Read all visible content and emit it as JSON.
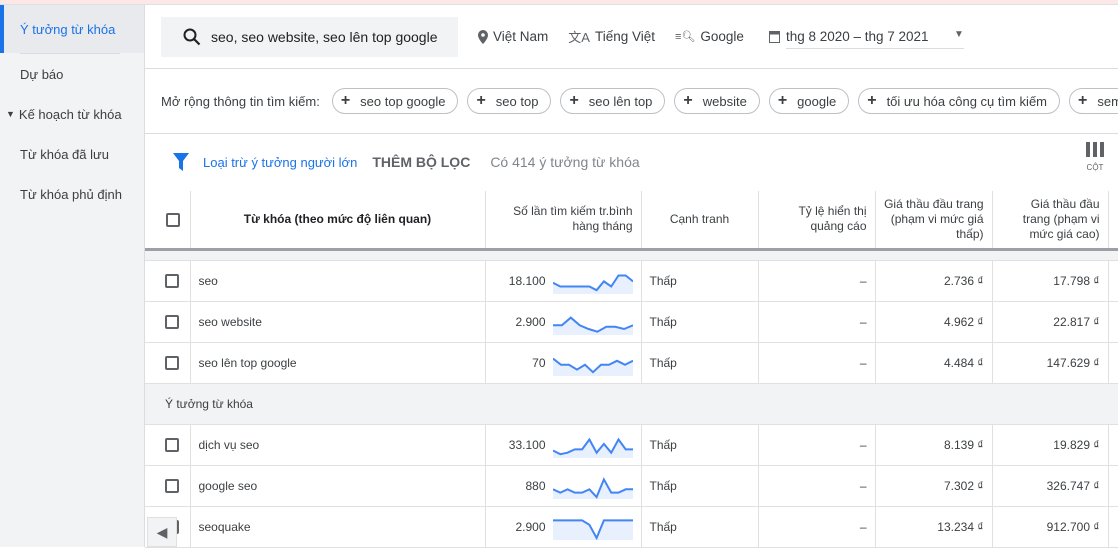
{
  "sidebar": {
    "items": [
      {
        "label": "Ý tưởng từ khóa",
        "active": true
      },
      {
        "label": "Dự báo"
      },
      {
        "label": "Kế hoạch từ khóa",
        "caret": true
      },
      {
        "label": "Từ khóa đã lưu"
      },
      {
        "label": "Từ khóa phủ định"
      }
    ]
  },
  "search": {
    "value": "seo, seo website, seo lên top google",
    "location": "Việt Nam",
    "language": "Tiếng Việt",
    "network": "Google",
    "date_range": "thg 8 2020 – thg 7 2021"
  },
  "broaden": {
    "label": "Mở rộng thông tin tìm kiếm:",
    "chips": [
      "seo top google",
      "seo top",
      "seo lên top",
      "website",
      "google",
      "tối ưu hóa công cụ tìm kiếm",
      "sem"
    ]
  },
  "filters": {
    "exclude_adult": "Loại trừ ý tưởng người lớn",
    "add_filter": "THÊM BỘ LỌC",
    "count": "Có 414 ý tưởng từ khóa",
    "columns": "CỘT"
  },
  "table": {
    "headers": [
      "Từ khóa (theo mức độ liên quan)",
      "Số lần tìm kiếm tr.bình hàng tháng",
      "Cạnh tranh",
      "Tỷ lệ hiển thị quảng cáo",
      "Giá thầu đầu trang (phạm vi mức giá thấp)",
      "Giá thầu đầu trang (phạm vi mức giá cao)"
    ],
    "provided": [
      {
        "keyword": "seo",
        "searches": "18.100",
        "trend": [
          42,
          25,
          25,
          25,
          25,
          25,
          8,
          48,
          25,
          75,
          75,
          48
        ],
        "competition": "Thấp",
        "impression": "–",
        "low": "2.736 ₫",
        "high": "17.798 ₫"
      },
      {
        "keyword": "seo website",
        "searches": "2.900",
        "trend": [
          35,
          35,
          70,
          35,
          18,
          6,
          28,
          28,
          18,
          35
        ],
        "competition": "Thấp",
        "impression": "–",
        "low": "4.962 ₫",
        "high": "22.817 ₫"
      },
      {
        "keyword": "seo lên top google",
        "searches": "70",
        "trend": [
          70,
          42,
          42,
          20,
          42,
          8,
          42,
          42,
          60,
          42,
          60
        ],
        "competition": "Thấp",
        "impression": "–",
        "low": "4.484 ₫",
        "high": "147.629 ₫"
      }
    ],
    "group_label": "Ý tưởng từ khóa",
    "ideas": [
      {
        "keyword": "dịch vụ seo",
        "searches": "33.100",
        "trend": [
          25,
          8,
          15,
          30,
          30,
          75,
          15,
          55,
          15,
          75,
          30,
          30
        ],
        "competition": "Thấp",
        "impression": "–",
        "low": "8.139 ₫",
        "high": "19.829 ₫"
      },
      {
        "keyword": "google seo",
        "searches": "880",
        "trend": [
          35,
          20,
          35,
          20,
          20,
          35,
          0,
          80,
          20,
          20,
          35,
          35
        ],
        "competition": "Thấp",
        "impression": "–",
        "low": "7.302 ₫",
        "high": "326.747 ₫"
      },
      {
        "keyword": "seoquake",
        "searches": "2.900",
        "trend": [
          80,
          80,
          80,
          80,
          80,
          60,
          0,
          80,
          80,
          80,
          80,
          80
        ],
        "competition": "Thấp",
        "impression": "–",
        "low": "13.234 ₫",
        "high": "912.700 ₫"
      }
    ]
  },
  "colors": {
    "accent": "#1a73e8",
    "spark_line": "#4285f4",
    "spark_fill": "#e8f0fe"
  }
}
